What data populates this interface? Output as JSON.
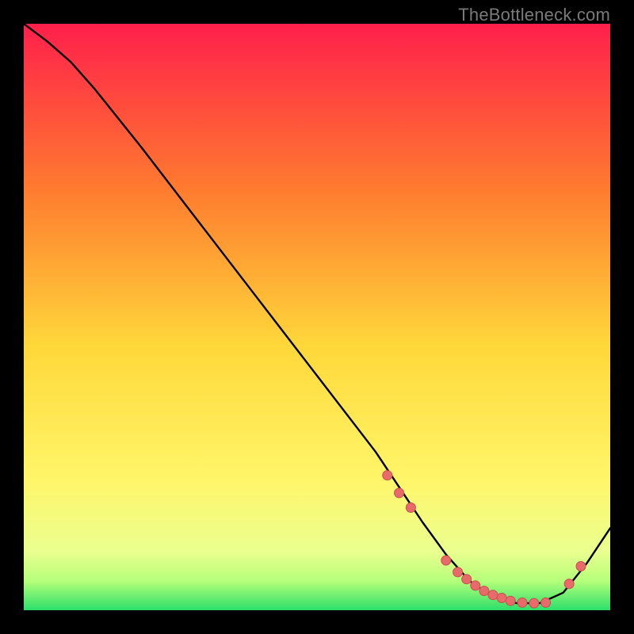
{
  "watermark": "TheBottleneck.com",
  "colors": {
    "bg_black": "#000000",
    "grad_top": "#ff1f4b",
    "grad_mid_upper": "#ff7a2f",
    "grad_mid": "#ffd83a",
    "grad_mid_lower": "#fff66a",
    "grad_green_light": "#b6ff7a",
    "grad_green": "#2bdf6a",
    "curve_stroke": "#000000",
    "dot_fill": "#e86a6a",
    "dot_stroke": "#c94f4f"
  },
  "chart_data": {
    "type": "line",
    "title": "",
    "xlabel": "",
    "ylabel": "",
    "xlim": [
      0,
      100
    ],
    "ylim": [
      0,
      100
    ],
    "note": "Axis tick labels are not rendered in the image; values below are estimated from pixel positions on a 0–100 scale.",
    "series": [
      {
        "name": "bottleneck-curve",
        "x": [
          0,
          4,
          8,
          12,
          20,
          30,
          40,
          50,
          60,
          64,
          68,
          72,
          76,
          80,
          84,
          88,
          92,
          96,
          100
        ],
        "y": [
          100,
          97,
          93.5,
          89,
          79,
          66,
          53,
          40,
          27,
          21,
          15,
          9.5,
          5,
          2.3,
          1.2,
          1.2,
          3,
          8,
          14
        ]
      }
    ],
    "scatter_points": {
      "name": "highlighted-points",
      "x": [
        62,
        64,
        66,
        72,
        74,
        75.5,
        77,
        78.5,
        80,
        81.5,
        83,
        85,
        87,
        89,
        93,
        95
      ],
      "y": [
        23,
        20,
        17.5,
        8.5,
        6.5,
        5.3,
        4.2,
        3.3,
        2.6,
        2.1,
        1.6,
        1.3,
        1.2,
        1.3,
        4.5,
        7.5
      ]
    }
  }
}
